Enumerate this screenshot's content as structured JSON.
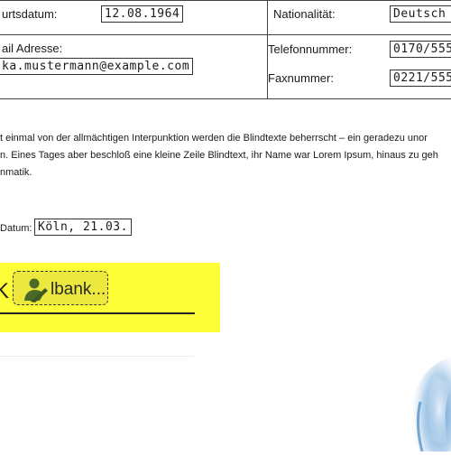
{
  "form": {
    "birthdate_label": "urtsdatum:",
    "birthdate_value": "12.08.1964",
    "nationality_label": "Nationalität:",
    "nationality_value": "Deutsch",
    "email_label": "ail Adresse:",
    "email_value": "ka.mustermann@example.com",
    "phone_label": "Telefonnummer:",
    "phone_value": "0170/555",
    "fax_label": "Faxnummer:",
    "fax_value": "0221/555"
  },
  "body_text": {
    "line1": "t einmal von der allmächtigen Interpunktion werden die Blindtexte beherrscht – ein geradezu unor",
    "line2": "n. Eines Tages aber beschloß eine kleine Zeile Blindtext, ihr Name war Lorem Ipsum, hinaus zu geh",
    "line3": "nmatik."
  },
  "date_field": {
    "label": "Datum:",
    "value": "Köln, 21.03."
  },
  "signature": {
    "partial_char": "K",
    "button_label": "lbank...",
    "button_icon": "person-pen-icon",
    "highlight_color": "#fdfd38",
    "button_color": "#ece83d"
  },
  "decoration": {
    "watercolor_color": "#5b9bd5"
  }
}
